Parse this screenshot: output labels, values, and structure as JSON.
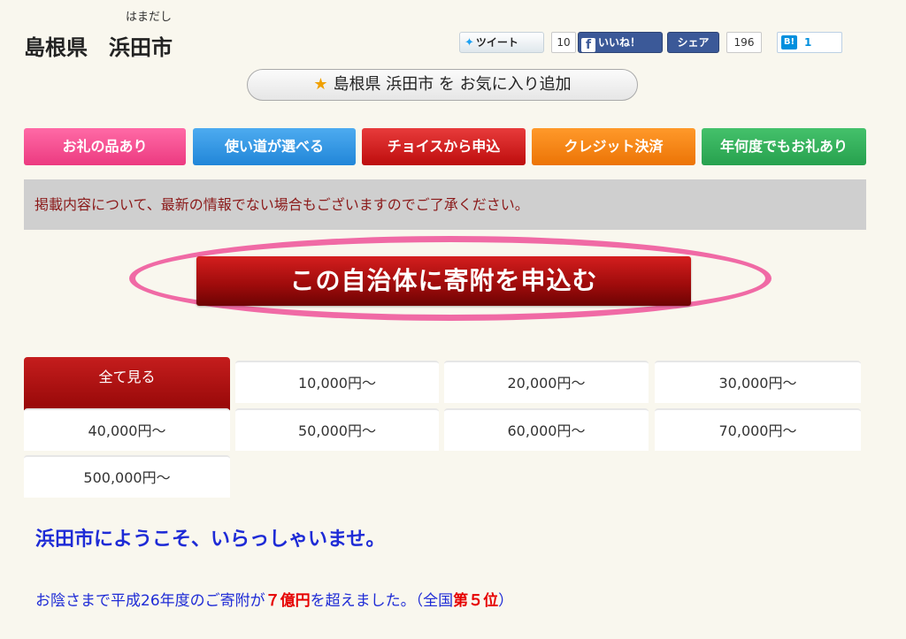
{
  "header": {
    "furigana": "はまだし",
    "title": "島根県　浜田市"
  },
  "social": {
    "tweet_label": "ツイート",
    "tweet_count": "10",
    "like_label": "いいね！",
    "share_label": "シェア",
    "share_count": "196",
    "hatena_icon": "B!",
    "hatena_count": "1"
  },
  "favorite": {
    "icon": "star-icon",
    "label": "島根県 浜田市 を お気に入り追加"
  },
  "tags": [
    {
      "label": "お礼の品あり",
      "color": "#ec3a80"
    },
    {
      "label": "使い道が選べる",
      "color": "#2186d8"
    },
    {
      "label": "チョイスから申込",
      "color": "#bd0d0d"
    },
    {
      "label": "クレジット決済",
      "color": "#ec7406"
    },
    {
      "label": "年何度でもお礼あり",
      "color": "#27a14e"
    }
  ],
  "notice": "掲載内容について、最新の情報でない場合もございますのでご了承ください。",
  "apply_button": "この自治体に寄附を申込む",
  "price_tabs": [
    {
      "label": "全て見る",
      "active": true
    },
    {
      "label": "10,000円〜"
    },
    {
      "label": "20,000円〜"
    },
    {
      "label": "30,000円〜"
    },
    {
      "label": "40,000円〜"
    },
    {
      "label": "50,000円〜"
    },
    {
      "label": "60,000円〜"
    },
    {
      "label": "70,000円〜"
    },
    {
      "label": "500,000円〜"
    }
  ],
  "welcome": "浜田市にようこそ、いらっしゃいませ。",
  "donation_note": {
    "prefix": "お陰さまで平成26年度のご寄附が",
    "amount": "７億円",
    "middle": "を超えました。（全国",
    "rank": "第５位",
    "suffix": "）"
  },
  "colors": {
    "background": "#f9f7ee",
    "accent_red": "#a10c0c",
    "highlight_pink": "#f06aa5",
    "welcome_blue": "#1e2bd6"
  }
}
